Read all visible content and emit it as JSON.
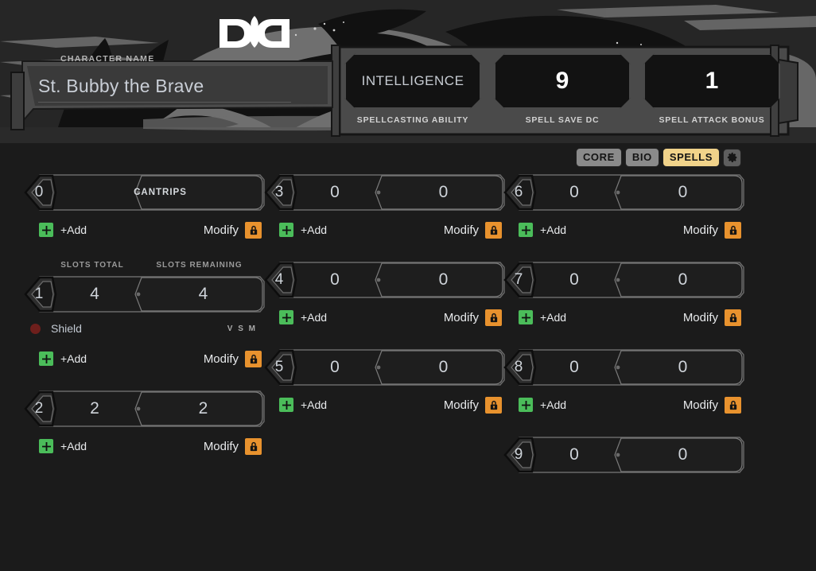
{
  "header": {
    "logo_icon": "dnd-ampersand-logo",
    "character_name": "St. Bubby the Brave",
    "character_name_placeholder": "Character Name",
    "character_name_label": "CHARACTER NAME"
  },
  "spell_stats": [
    {
      "value": "INTELLIGENCE",
      "caption": "SPELLCASTING ABILITY",
      "kind": "text"
    },
    {
      "value": "9",
      "caption": "SPELL SAVE DC",
      "kind": "number"
    },
    {
      "value": "1",
      "caption": "SPELL ATTACK BONUS",
      "kind": "number"
    }
  ],
  "tabs": [
    {
      "label": "CORE",
      "active": false
    },
    {
      "label": "BIO",
      "active": false
    },
    {
      "label": "SPELLS",
      "active": true
    }
  ],
  "settings_icon": "gear-icon",
  "slot_headers": {
    "total": "SLOTS TOTAL",
    "remaining": "SLOTS REMAINING"
  },
  "actions": {
    "add_label": "+Add",
    "add_icon": "plus-icon",
    "modify_label": "Modify",
    "lock_icon": "lock-icon"
  },
  "colors": {
    "background": "#1b1b1b",
    "accent_tab": "#f1d38a",
    "add_green": "#4bbd5a",
    "lock_orange": "#e8922e",
    "spell_dot_red": "#6e1f1c",
    "text_primary": "#cfd4da"
  },
  "columns": [
    {
      "levels": [
        {
          "level": "0",
          "title": "CANTRIPS",
          "show_slot_headers": false,
          "show_slots": false,
          "spells": [],
          "show_actions": true
        },
        {
          "level": "1",
          "title": "",
          "show_slot_headers": true,
          "show_slots": true,
          "slots_total": "4",
          "slots_remaining": "4",
          "spells": [
            {
              "name": "Shield",
              "components": "V S M",
              "prepared": false
            }
          ],
          "show_actions": true
        },
        {
          "level": "2",
          "title": "",
          "show_slot_headers": false,
          "show_slots": true,
          "slots_total": "2",
          "slots_remaining": "2",
          "spells": [],
          "show_actions": true
        }
      ]
    },
    {
      "levels": [
        {
          "level": "3",
          "title": "",
          "show_slot_headers": false,
          "show_slots": true,
          "slots_total": "0",
          "slots_remaining": "0",
          "spells": [],
          "show_actions": true
        },
        {
          "level": "4",
          "title": "",
          "show_slot_headers": false,
          "show_slots": true,
          "slots_total": "0",
          "slots_remaining": "0",
          "spells": [],
          "show_actions": true
        },
        {
          "level": "5",
          "title": "",
          "show_slot_headers": false,
          "show_slots": true,
          "slots_total": "0",
          "slots_remaining": "0",
          "spells": [],
          "show_actions": true
        }
      ]
    },
    {
      "levels": [
        {
          "level": "6",
          "title": "",
          "show_slot_headers": false,
          "show_slots": true,
          "slots_total": "0",
          "slots_remaining": "0",
          "spells": [],
          "show_actions": true
        },
        {
          "level": "7",
          "title": "",
          "show_slot_headers": false,
          "show_slots": true,
          "slots_total": "0",
          "slots_remaining": "0",
          "spells": [],
          "show_actions": true
        },
        {
          "level": "8",
          "title": "",
          "show_slot_headers": false,
          "show_slots": true,
          "slots_total": "0",
          "slots_remaining": "0",
          "spells": [],
          "show_actions": true
        },
        {
          "level": "9",
          "title": "",
          "show_slot_headers": false,
          "show_slots": true,
          "slots_total": "0",
          "slots_remaining": "0",
          "spells": [],
          "show_actions": false
        }
      ]
    }
  ]
}
